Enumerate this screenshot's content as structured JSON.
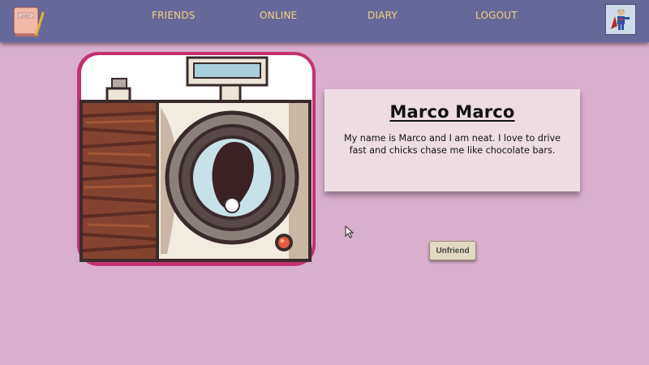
{
  "nav": {
    "logo_text": "DIARY",
    "links": [
      "FRIENDS",
      "ONLINE",
      "DIARY",
      "LOGOUT"
    ],
    "text_color": "#f4d27a",
    "background": "#67689a"
  },
  "profile": {
    "name": "Marco Marco",
    "bio": "My name is Marco and I am neat. I love to drive fast and chicks chase me like chocolate bars.",
    "photo_icon": "camera-illustration",
    "avatar_icon": "superhero-avatar"
  },
  "actions": {
    "unfriend_label": "Unfriend"
  },
  "colors": {
    "page_background": "#d9afcd",
    "card_background": "#eddde3",
    "photo_border": "#c2326f"
  }
}
